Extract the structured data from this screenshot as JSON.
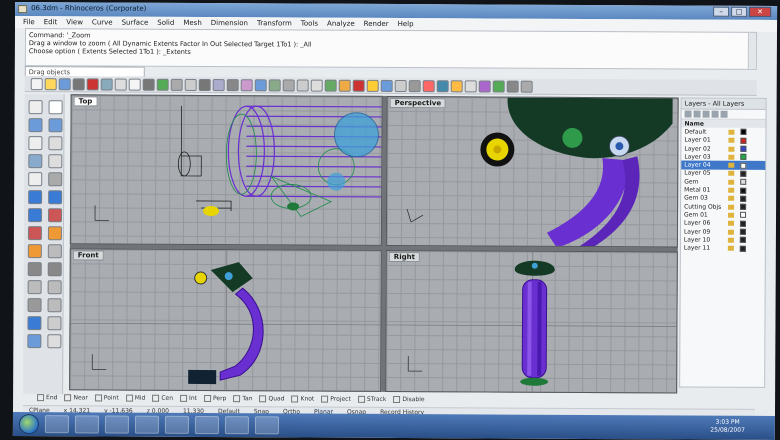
{
  "window": {
    "title": "06.3dm - Rhinoceros (Corporate)"
  },
  "menu": [
    "File",
    "Edit",
    "View",
    "Curve",
    "Surface",
    "Solid",
    "Mesh",
    "Dimension",
    "Transform",
    "Tools",
    "Analyze",
    "Render",
    "Help"
  ],
  "command_history": [
    "Command: '_Zoom",
    "Drag a window to zoom ( All Dynamic Extents Factor In Out Selected Target 1To1 ): _All",
    "Choose option ( Extents Selected 1To1 ): _Extents"
  ],
  "command_input": "Drag objects",
  "viewports": {
    "top": "Top",
    "perspective": "Perspective",
    "front": "Front",
    "right": "Right"
  },
  "layers": {
    "title": "Layers - All Layers",
    "header": "Name",
    "rows": [
      {
        "name": "Default",
        "color": "#000000"
      },
      {
        "name": "Layer 01",
        "color": "#cc2222"
      },
      {
        "name": "Layer 02",
        "color": "#3344cc"
      },
      {
        "name": "Layer 03",
        "color": "#22aa44"
      },
      {
        "name": "Layer 04",
        "color": "#ffffff"
      },
      {
        "name": "Layer 05",
        "color": "#222222"
      },
      {
        "name": "Gem",
        "color": "#dddddd"
      },
      {
        "name": "Metal 01",
        "color": "#111111"
      },
      {
        "name": "Gem 03",
        "color": "#222222"
      },
      {
        "name": "Cutting Objs",
        "color": "#222222"
      },
      {
        "name": "Gem 01",
        "color": "#ffffff"
      },
      {
        "name": "Layer 06",
        "color": "#222222"
      },
      {
        "name": "Layer 09",
        "color": "#222222"
      },
      {
        "name": "Layer 10",
        "color": "#222222"
      },
      {
        "name": "Layer 11",
        "color": "#222222"
      }
    ],
    "selected_index": 5
  },
  "osnaps": [
    "End",
    "Near",
    "Point",
    "Mid",
    "Cen",
    "Int",
    "Perp",
    "Tan",
    "Quad",
    "Knot",
    "Project",
    "STrack",
    "Disable"
  ],
  "status": {
    "cplane": "CPlane",
    "x": "x 14.321",
    "y": "y -11.636",
    "z": "z 0.000",
    "d": "11.330",
    "layer": "Default",
    "toggles": [
      "Snap",
      "Ortho",
      "Planar",
      "Osnap",
      "Record History"
    ]
  },
  "clock": {
    "time": "3:03 PM",
    "date": "25/08/2007"
  },
  "colors": {
    "model_purple": "#6a2fd0",
    "gem_green": "#1f7a3a",
    "accent_blue": "#3f78c9"
  }
}
